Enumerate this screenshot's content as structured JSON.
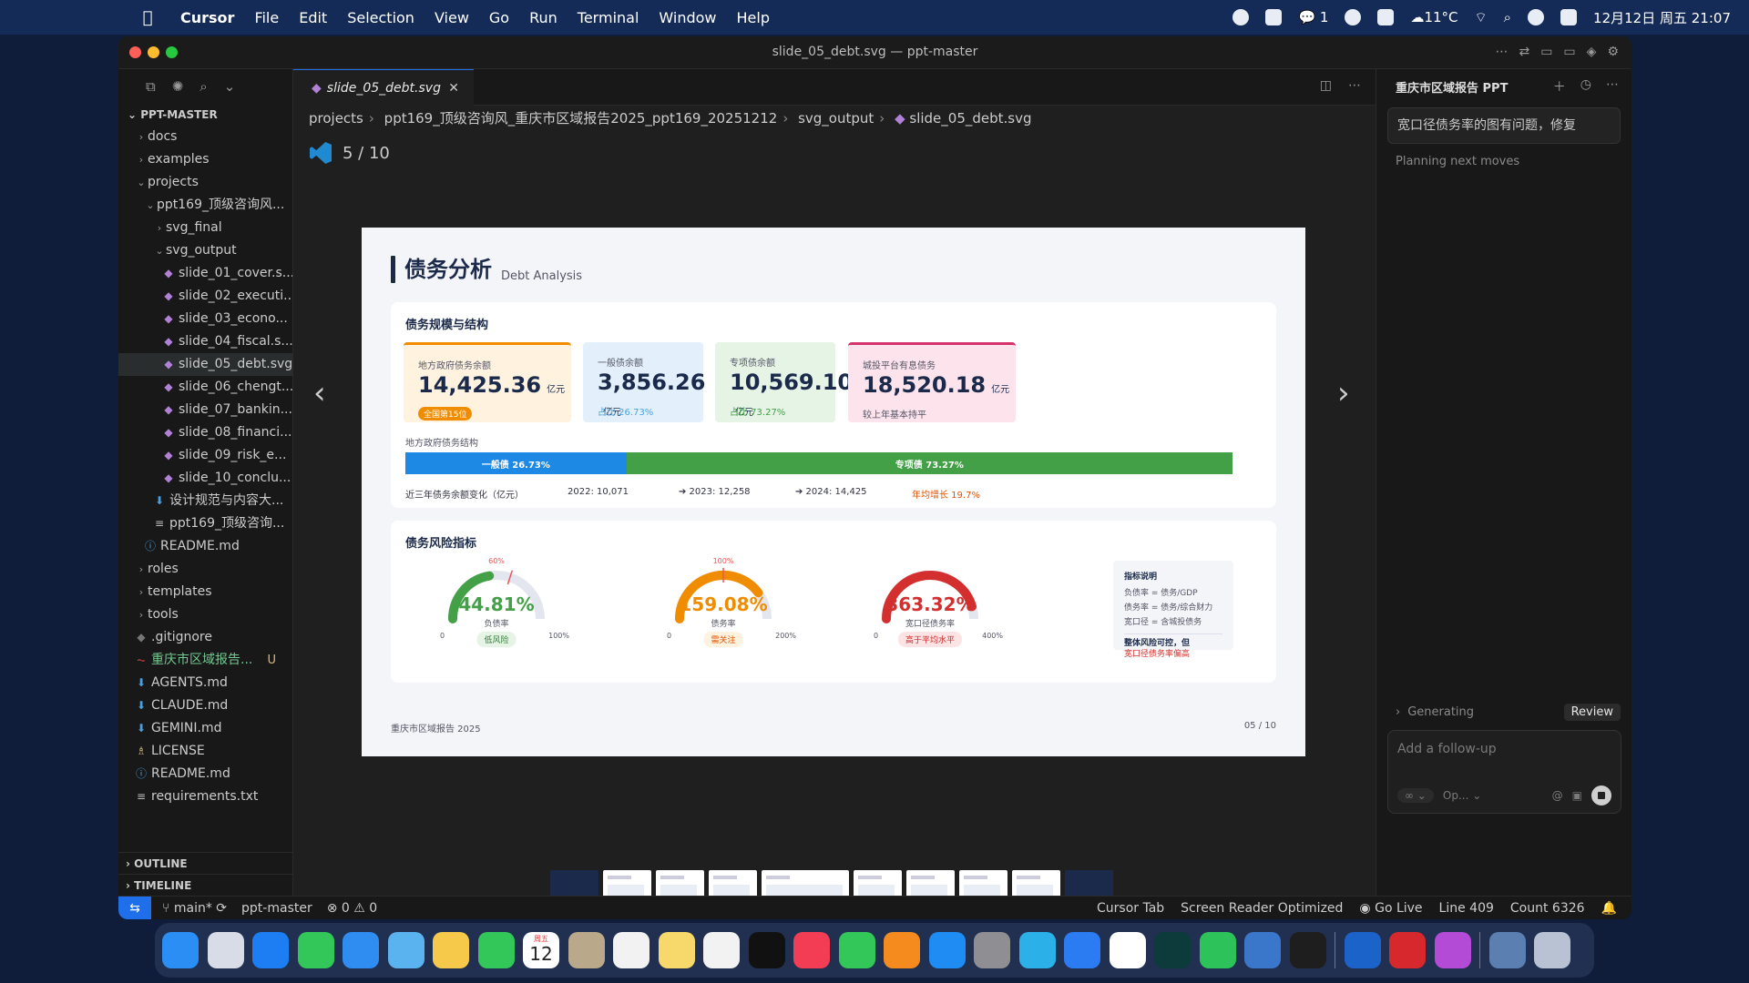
{
  "menubar": {
    "app_name": "Cursor",
    "items": [
      "File",
      "Edit",
      "Selection",
      "View",
      "Go",
      "Run",
      "Terminal",
      "Window",
      "Help"
    ],
    "wechat_count": "1",
    "weather": "11°C",
    "datetime": "12月12日 周五 21:07"
  },
  "window": {
    "title": "slide_05_debt.svg — ppt-master"
  },
  "explorer": {
    "root": "PPT-MASTER",
    "items": [
      {
        "label": "docs",
        "depth": 1,
        "kind": "folder",
        "open": false
      },
      {
        "label": "examples",
        "depth": 1,
        "kind": "folder",
        "open": false
      },
      {
        "label": "projects",
        "depth": 1,
        "kind": "folder",
        "open": true
      },
      {
        "label": "ppt169_顶级咨询风...",
        "depth": 2,
        "kind": "folder",
        "open": true
      },
      {
        "label": "svg_final",
        "depth": 3,
        "kind": "folder",
        "open": false
      },
      {
        "label": "svg_output",
        "depth": 3,
        "kind": "folder",
        "open": true
      },
      {
        "label": "slide_01_cover.s...",
        "depth": 4,
        "kind": "svg"
      },
      {
        "label": "slide_02_executi...",
        "depth": 4,
        "kind": "svg"
      },
      {
        "label": "slide_03_econo...",
        "depth": 4,
        "kind": "svg"
      },
      {
        "label": "slide_04_fiscal.s...",
        "depth": 4,
        "kind": "svg"
      },
      {
        "label": "slide_05_debt.svg",
        "depth": 4,
        "kind": "svg",
        "selected": true
      },
      {
        "label": "slide_06_chengt...",
        "depth": 4,
        "kind": "svg"
      },
      {
        "label": "slide_07_bankin...",
        "depth": 4,
        "kind": "svg"
      },
      {
        "label": "slide_08_financi...",
        "depth": 4,
        "kind": "svg"
      },
      {
        "label": "slide_09_risk_e...",
        "depth": 4,
        "kind": "svg"
      },
      {
        "label": "slide_10_conclu...",
        "depth": 4,
        "kind": "svg"
      },
      {
        "label": "设计规范与内容大...",
        "depth": 3,
        "kind": "md"
      },
      {
        "label": "ppt169_顶级咨询...",
        "depth": 3,
        "kind": "txt"
      },
      {
        "label": "README.md",
        "depth": 2,
        "kind": "info"
      },
      {
        "label": "roles",
        "depth": 1,
        "kind": "folder",
        "open": false
      },
      {
        "label": "templates",
        "depth": 1,
        "kind": "folder",
        "open": false
      },
      {
        "label": "tools",
        "depth": 1,
        "kind": "folder",
        "open": false
      },
      {
        "label": ".gitignore",
        "depth": 1,
        "kind": "git"
      },
      {
        "label": "重庆市区域报告...",
        "depth": 1,
        "kind": "pdf",
        "badge": "U"
      },
      {
        "label": "AGENTS.md",
        "depth": 1,
        "kind": "md"
      },
      {
        "label": "CLAUDE.md",
        "depth": 1,
        "kind": "md"
      },
      {
        "label": "GEMINI.md",
        "depth": 1,
        "kind": "md"
      },
      {
        "label": "LICENSE",
        "depth": 1,
        "kind": "license"
      },
      {
        "label": "README.md",
        "depth": 1,
        "kind": "info"
      },
      {
        "label": "requirements.txt",
        "depth": 1,
        "kind": "txt"
      }
    ],
    "outline": "OUTLINE",
    "timeline": "TIMELINE"
  },
  "editor": {
    "tab_label": "slide_05_debt.svg",
    "breadcrumb": [
      "projects",
      "ppt169_顶级咨询风_重庆市区域报告2025_ppt169_20251212",
      "svg_output",
      "slide_05_debt.svg"
    ],
    "page_indicator": "5 / 10"
  },
  "slide": {
    "title": "债务分析",
    "subtitle": "Debt Analysis",
    "scale_card_title": "债务规模与结构",
    "kpis": [
      {
        "label": "地方政府债务余额",
        "value": "14,425.36",
        "unit": "亿元",
        "badge": "全国第15位",
        "color": "#f08c00",
        "bg": "#fff3e0"
      },
      {
        "label": "一般债余额",
        "value": "3,856.26",
        "unit": "亿元",
        "note": "占比 26.73%",
        "color": "#4aa3e0",
        "bg": "#e3f0fb"
      },
      {
        "label": "专项债余额",
        "value": "10,569.10",
        "unit": "亿元",
        "note": "占比 73.27%",
        "color": "#43a047",
        "bg": "#e6f4e6"
      },
      {
        "label": "城投平台有息债务",
        "value": "18,520.18",
        "unit": "亿元",
        "note": "较上年基本持平",
        "color": "#d6336c",
        "bg": "#fde4ec"
      }
    ],
    "structure_label": "地方政府债务结构",
    "structure_bar": [
      {
        "label": "一般债 26.73%",
        "share": 26.73,
        "color": "#1e88e5"
      },
      {
        "label": "专项债 73.27%",
        "share": 73.27,
        "color": "#43a047"
      }
    ],
    "trend": {
      "label": "近三年债务余额变化（亿元）",
      "points": [
        "2022: 10,071",
        "➔ 2023: 12,258",
        "➔ 2024: 14,425"
      ],
      "growth": "年均增长 19.7%"
    },
    "risk_card_title": "债务风险指标",
    "gauges": [
      {
        "value": "44.81%",
        "fraction": 0.4481,
        "label": "负债率",
        "badge": "低风险",
        "min": "0",
        "max": "100%",
        "threshold": "60%",
        "threshold_fraction": 0.6,
        "color": "#43a047",
        "badge_bg": "#e6f4e6",
        "badge_color": "#2e7d32"
      },
      {
        "value": "159.08%",
        "fraction": 0.7954,
        "label": "债务率",
        "badge": "需关注",
        "min": "0",
        "max": "200%",
        "threshold": "100%",
        "threshold_fraction": 0.5,
        "color": "#f08c00",
        "badge_bg": "#fff3e0",
        "badge_color": "#e65100"
      },
      {
        "value": "363.32%",
        "fraction": 0.9083,
        "label": "宽口径债务率",
        "badge": "高于平均水平",
        "min": "0",
        "max": "400%",
        "color": "#d32f2f",
        "badge_bg": "#fde4e4",
        "badge_color": "#c62828"
      }
    ],
    "legend": {
      "title": "指标说明",
      "lines": [
        "负债率 = 债务/GDP",
        "债务率 = 债务/综合财力",
        "宽口径 = 含城投债务"
      ],
      "conclusion": "整体风险可控，但",
      "conclusion_alert": "宽口径债务率偏高"
    },
    "footer_left": "重庆市区域报告 2025",
    "footer_right": "05 / 10"
  },
  "chat": {
    "title": "重庆市区域报告 PPT",
    "user_message": "宽口径债务率的图有问题，修复",
    "status": "Planning next moves",
    "generating": "Generating",
    "review": "Review",
    "input_placeholder": "Add a follow-up",
    "mode_label": "Op..."
  },
  "statusbar": {
    "branch": "main*",
    "project": "ppt-master",
    "problems": "⊗ 0 ⚠ 0",
    "cursor_tab": "Cursor Tab",
    "screen_reader": "Screen Reader Optimized",
    "go_live": "Go Live",
    "line": "Line 409",
    "count": "Count 6326"
  },
  "dock": {
    "calendar_day": "12",
    "calendar_month": "周五",
    "apps": [
      "finder",
      "launchpad",
      "safari",
      "messages",
      "mail",
      "maps",
      "photos",
      "facetime",
      "calendar",
      "contacts",
      "reminders",
      "notes",
      "freeform",
      "tv",
      "music",
      "numbers",
      "pages",
      "app-store",
      "settings",
      "edge",
      "keynote",
      "notion",
      "cursor",
      "wechat",
      "browser",
      "cursor-app",
      "mail-app",
      "acrobat",
      "app-cat",
      "downloads",
      "trash"
    ],
    "colors": [
      "#2b8ef5",
      "#d8dce6",
      "#1c7ef2",
      "#33c759",
      "#2f8cf0",
      "#5ab2ee",
      "#f6c94a",
      "#33c759",
      "#ffffff",
      "#b9a98a",
      "#f2f2f2",
      "#f7d86a",
      "#f2f2f2",
      "#111111",
      "#f23d55",
      "#33c759",
      "#f58a1f",
      "#1e8cf2",
      "#8e8e93",
      "#2bb0e8",
      "#2b7cf2",
      "#ffffff",
      "#0d3b3b",
      "#2ec25b",
      "#3a76c9",
      "#1e1e1e",
      "#1b63c9",
      "#d7282d",
      "#b44bd6",
      "#5a7fb0",
      "#b8c2d3"
    ]
  }
}
